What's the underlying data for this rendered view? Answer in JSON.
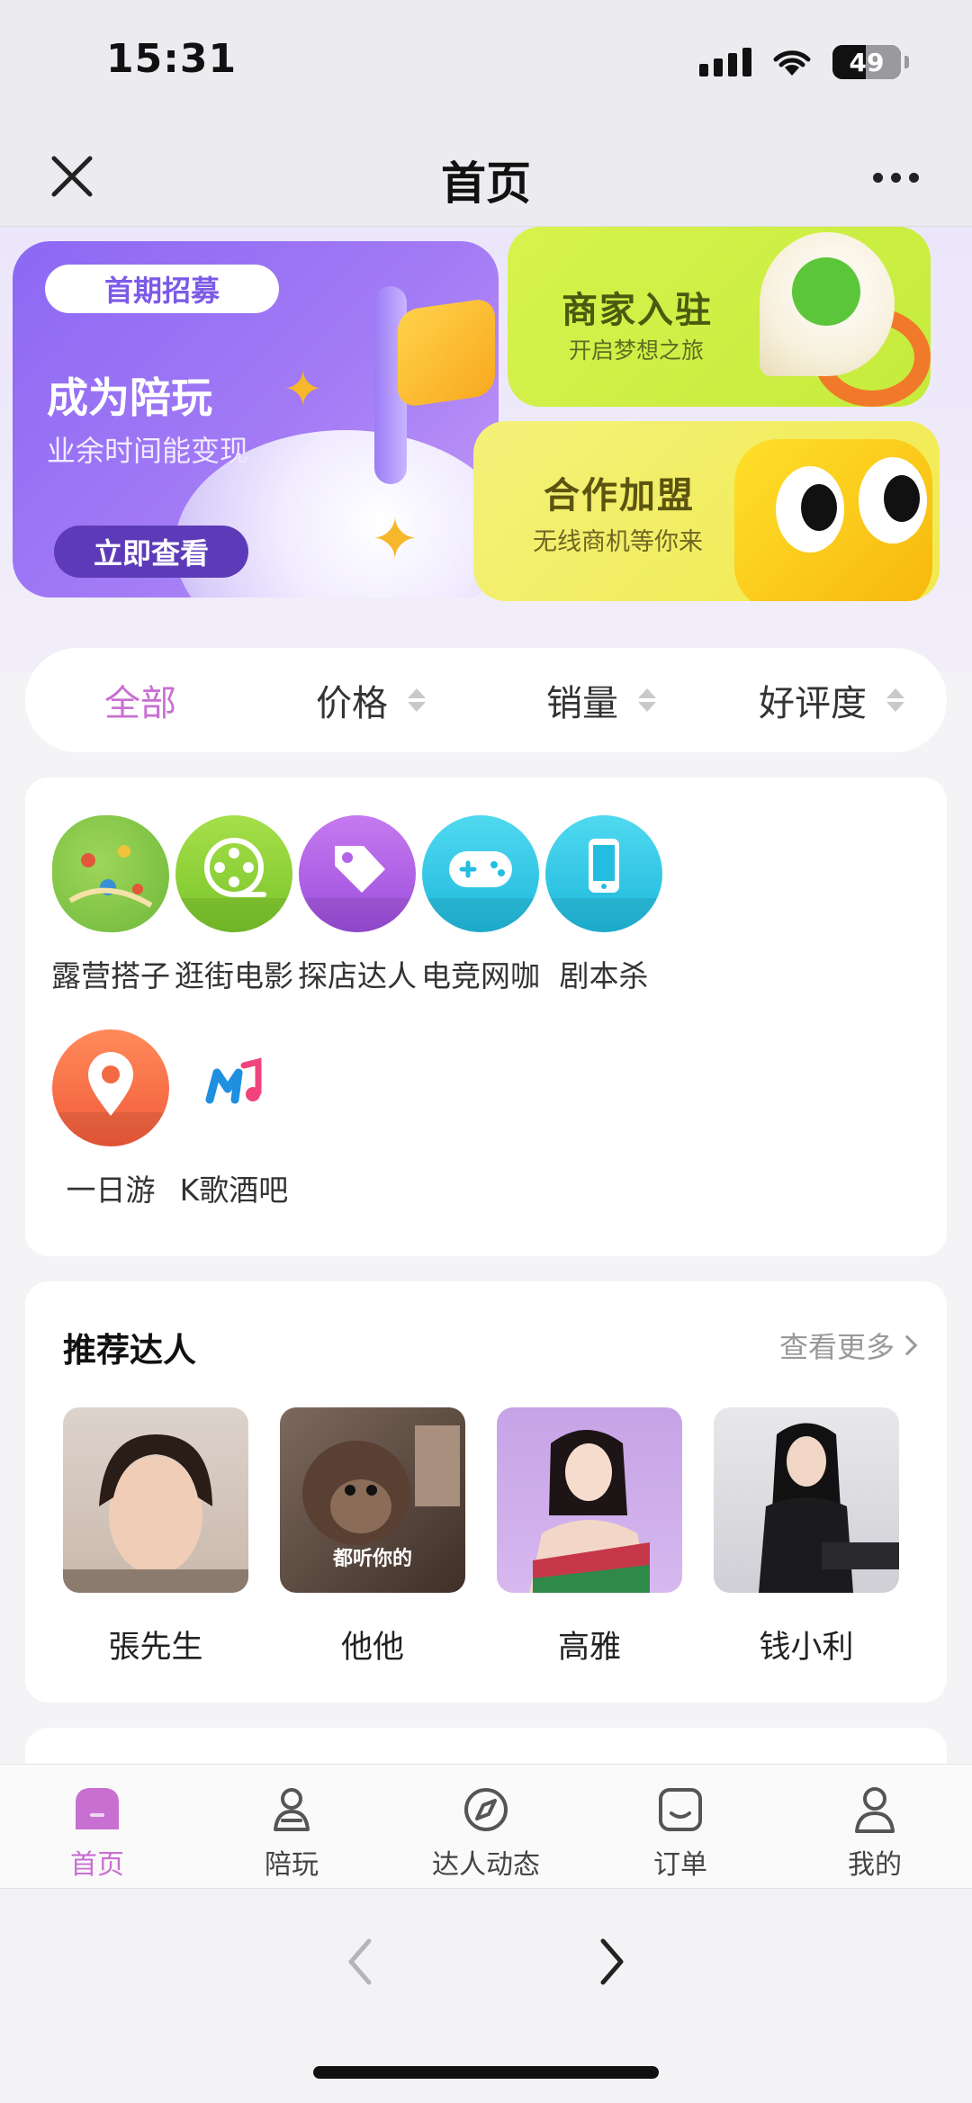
{
  "status": {
    "time": "15:31",
    "battery": "49",
    "battery_level": 0.49
  },
  "nav": {
    "title": "首页"
  },
  "banner": {
    "recruit": {
      "tag": "首期招募",
      "title": "成为陪玩",
      "subtitle": "业余时间能变现",
      "button": "立即查看"
    },
    "merchant": {
      "title": "商家入驻",
      "subtitle": "开启梦想之旅"
    },
    "join": {
      "title": "合作加盟",
      "subtitle": "无线商机等你来"
    }
  },
  "filters": [
    {
      "label": "全部",
      "active": true
    },
    {
      "label": "价格"
    },
    {
      "label": "销量"
    },
    {
      "label": "好评度"
    }
  ],
  "categories": [
    {
      "label": "露营搭子",
      "icon": "camping-map-icon"
    },
    {
      "label": "逛街电影",
      "icon": "film-reel-icon"
    },
    {
      "label": "探店达人",
      "icon": "tag-icon"
    },
    {
      "label": "电竞网咖",
      "icon": "gamepad-icon"
    },
    {
      "label": "剧本杀",
      "icon": "phone-icon"
    },
    {
      "label": "一日游",
      "icon": "location-pin-icon"
    },
    {
      "label": "K歌酒吧",
      "icon": "music-note-icon"
    }
  ],
  "recommend": {
    "title": "推荐达人",
    "more": "查看更多",
    "talents": [
      {
        "name": "張先生"
      },
      {
        "name": "他他",
        "caption": "都听你的"
      },
      {
        "name": "高雅"
      },
      {
        "name": "钱小利"
      }
    ]
  },
  "tabs": [
    {
      "label": "首页",
      "icon": "home-icon",
      "active": true
    },
    {
      "label": "陪玩",
      "icon": "companion-icon"
    },
    {
      "label": "达人动态",
      "icon": "compass-icon"
    },
    {
      "label": "订单",
      "icon": "order-icon"
    },
    {
      "label": "我的",
      "icon": "user-icon"
    }
  ],
  "colors": {
    "accent": "#c86fd2",
    "recruit": "#8c68f4",
    "merchant": "#d8f24e",
    "join": "#f4f17a"
  }
}
